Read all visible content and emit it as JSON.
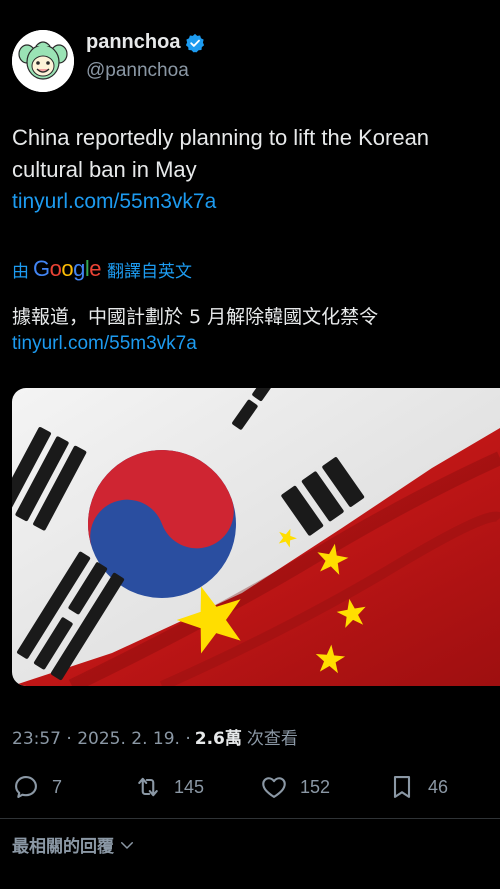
{
  "author": {
    "display_name": "pannchoa",
    "handle": "@pannchoa",
    "verified_icon": "verified-badge-icon"
  },
  "tweet": {
    "text": "China reportedly planning to lift the Korean cultural ban in May",
    "link": "tinyurl.com/55m3vk7a"
  },
  "translation": {
    "by_label": "由",
    "provider_letters": [
      "G",
      "o",
      "o",
      "g",
      "l",
      "e"
    ],
    "label": "翻譯自英文",
    "text": "據報道，中國計劃於 5 月解除韓國文化禁令",
    "link": "tinyurl.com/55m3vk7a"
  },
  "media": {
    "description_icon": "korea-china-flags-image"
  },
  "meta": {
    "time": "23:57 · 2025. 2. 19. · ",
    "views_count": "2.6萬",
    "views_label": "次查看"
  },
  "actions": {
    "replies": "7",
    "reposts": "145",
    "likes": "152",
    "bookmarks": "46"
  },
  "replies_sort": {
    "label": "最相關的回覆"
  },
  "colors": {
    "accent": "#1d9bf0",
    "background": "#000000",
    "text_primary": "#e7e9ea",
    "text_secondary": "#8b98a5"
  }
}
